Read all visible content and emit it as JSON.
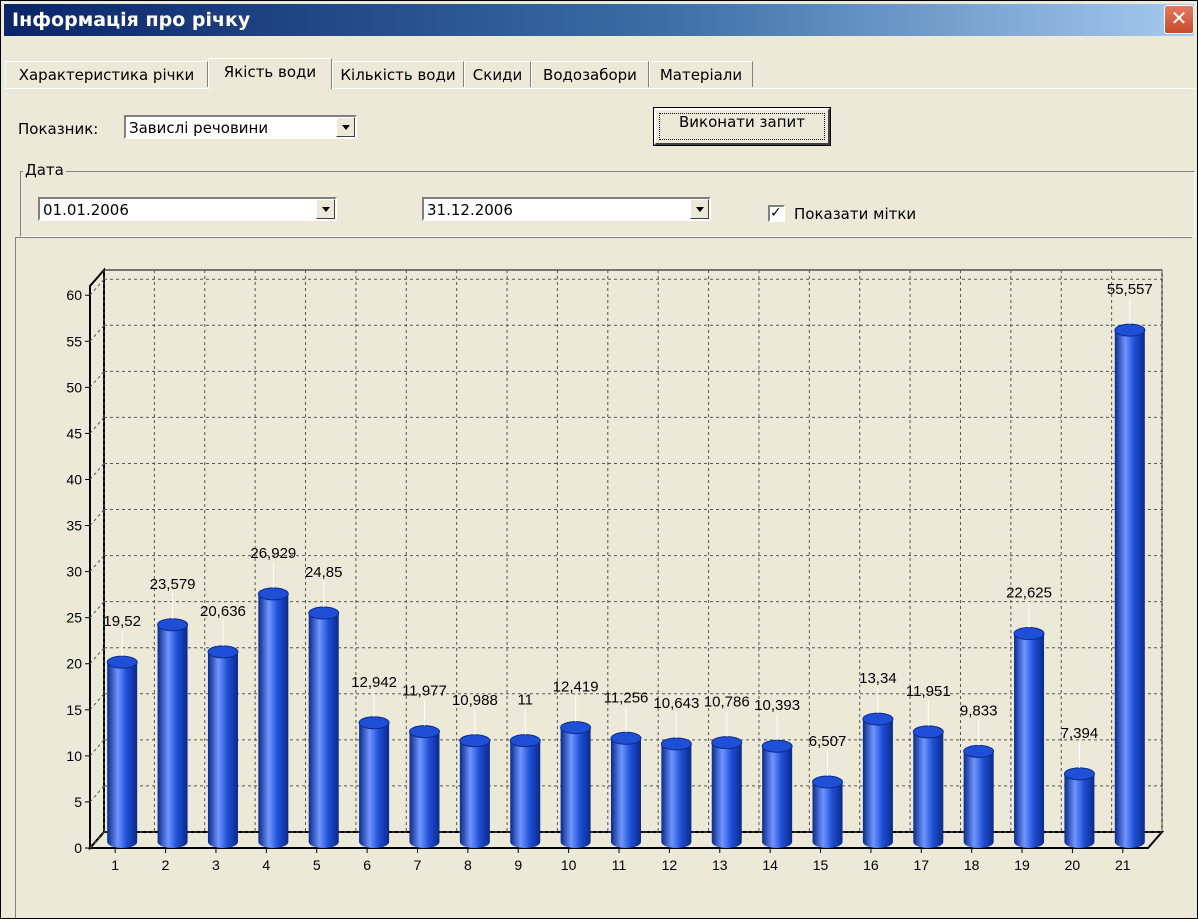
{
  "window": {
    "title": "Інформація про річку",
    "close_label": "✕"
  },
  "tabs": [
    {
      "label": "Характеристика річки",
      "active": false
    },
    {
      "label": "Якість води",
      "active": true
    },
    {
      "label": "Кількість води",
      "active": false
    },
    {
      "label": "Скиди",
      "active": false
    },
    {
      "label": "Водозабори",
      "active": false
    },
    {
      "label": "Матеріали",
      "active": false
    }
  ],
  "filters": {
    "indicator_label": "Показник:",
    "indicator_value": "Завислі речовини",
    "run_button": "Виконати запит",
    "date_group_label": "Дата",
    "date_from": "01.01.2006",
    "date_to": "31.12.2006",
    "show_labels_text": "Показати мітки",
    "show_labels_checked": true
  },
  "colors": {
    "bar": "#1f4fd6",
    "bar_dark": "#0a2a8a",
    "bar_light": "#6f95ff",
    "panel": "#ece9d8"
  },
  "chart_data": {
    "type": "bar",
    "style": "3d-cylinder",
    "categories": [
      "1",
      "2",
      "3",
      "4",
      "5",
      "6",
      "7",
      "8",
      "9",
      "10",
      "11",
      "12",
      "13",
      "14",
      "15",
      "16",
      "17",
      "18",
      "19",
      "20",
      "21"
    ],
    "values": [
      19.52,
      23.579,
      20.636,
      26.929,
      24.85,
      12.942,
      11.977,
      10.988,
      11,
      12.419,
      11.256,
      10.643,
      10.786,
      10.393,
      6.507,
      13.34,
      11.951,
      9.833,
      22.625,
      7.394,
      55.557
    ],
    "value_labels": [
      "19,52",
      "23,579",
      "20,636",
      "26,929",
      "24,85",
      "12,942",
      "11,977",
      "10,988",
      "11",
      "12,419",
      "11,256",
      "10,643",
      "10,786",
      "10,393",
      "6,507",
      "13,34",
      "11,951",
      "9,833",
      "22,625",
      "7,394",
      "55,557"
    ],
    "y_ticks": [
      0,
      5,
      10,
      15,
      20,
      25,
      30,
      35,
      40,
      45,
      50,
      55,
      60
    ],
    "ylim": [
      0,
      61
    ],
    "grid": true,
    "legend": "none"
  }
}
